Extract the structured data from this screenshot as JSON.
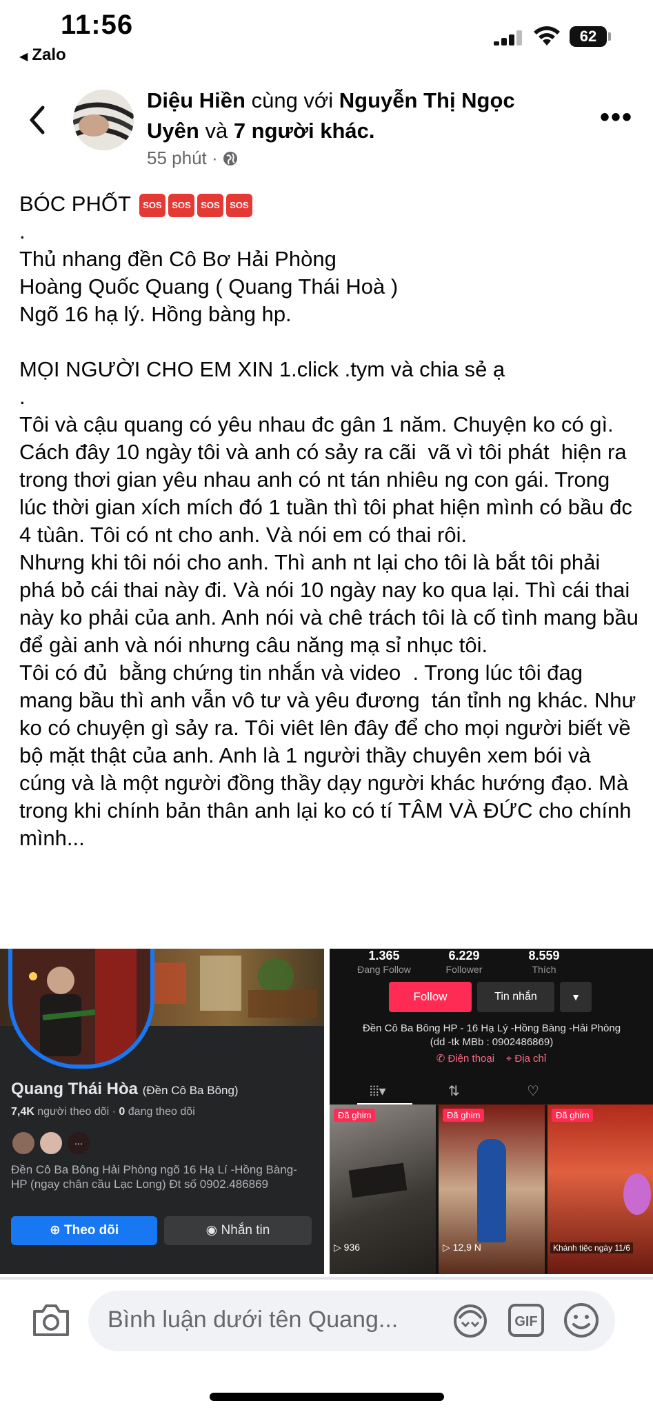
{
  "status_bar": {
    "time": "11:56",
    "back_app": "Zalo",
    "battery": "62"
  },
  "post": {
    "author": "Diệu Hiền",
    "with_text": "cùng với",
    "tagged": "Nguyễn Thị Ngọc Uyên",
    "and_text": "và",
    "others": "7 người khác",
    "time_ago": "55 phút",
    "title": "BÓC PHỐT",
    "sos_label": "SOS",
    "body": ".\nThủ nhang đền Cô Bơ Hải Phòng\nHoàng Quốc Quang ( Quang Thái Hoà )\nNgõ 16 hạ lý. Hồng bàng hp.\n\nMỌI NGƯỜI CHO EM XIN 1.click .tym và chia sẻ ạ\n.\nTôi và cậu quang có yêu nhau đc gân 1 năm. Chuyện ko có gì. Cách đây 10 ngày tôi và anh có sảy ra cãi  vã vì tôi phát  hiện ra trong thơi gian yêu nhau anh có nt tán nhiêu ng con gái. Trong lúc thời gian xích mích đó 1 tuần thì tôi phat hiện mình có bầu đc 4 tùân. Tôi có nt cho anh. Và nói em có thai rôi.\nNhưng khi tôi nói cho anh. Thì anh nt lại cho tôi là bắt tôi phải phá bỏ cái thai này đi. Và nói 10 ngày nay ko qua lại. Thì cái thai này ko phải của anh. Anh nói và chê trách tôi là cố tình mang bầu để gài anh và nói nhưng câu năng mạ sỉ nhục tôi.\nTôi có đủ  bằng chứng tin nhắn và video  . Trong lúc tôi đag mang bầu thì anh vẫn vô tư và yêu đương  tán tỉnh ng khác. Như ko có chuyện gì sảy ra. Tôi viêt lên đây để cho mọi người biết về bộ mặt thật của anh. Anh là 1 người thầy chuyên xem bói và cúng và là một người đồng thầy dạy người khác hướng đạo. Mà trong khi chính bản thân anh lại ko có tí TÂM VÀ ĐỨC cho chính mình..."
  },
  "fb_profile": {
    "name": "Quang Thái Hòa",
    "subname": "(Đền Cô Ba Bông)",
    "followers": "7,4K",
    "followers_label": "người theo dõi",
    "following": "0",
    "following_label": "đang theo dõi",
    "bio": "Đền Cô Ba Bông Hải Phòng ngõ 16 Hạ Lí -Hồng Bàng-HP (ngay chân cầu Lạc Long) Đt số 0902.486869",
    "follow_btn": "Theo dõi",
    "message_btn": "Nhắn tin",
    "more_dots": "..."
  },
  "tiktok_profile": {
    "stats": [
      {
        "num": "1.365",
        "label": "Đang Follow"
      },
      {
        "num": "6.229",
        "label": "Follower"
      },
      {
        "num": "8.559",
        "label": "Thích"
      }
    ],
    "follow_btn": "Follow",
    "message_btn": "Tin nhắn",
    "bio": "Đền Cô Ba Bông HP - 16 Hạ Lý -Hồng Bàng -Hải Phòng (dd -tk MBb : 0902486869)",
    "phone_link": "Điện thoại",
    "address_link": "Địa chỉ",
    "pinned_label": "Đã ghim",
    "videos": [
      {
        "views": "936"
      },
      {
        "views": "12,9 N"
      },
      {
        "views": ""
      }
    ],
    "video3_caption": "Khánh tiệc ngày 11/6"
  },
  "comment_bar": {
    "placeholder": "Bình luận dưới tên Quang..."
  },
  "colors": {
    "fb_blue": "#1877f2",
    "tiktok_red": "#fe2c55",
    "sos_red": "#e53935"
  }
}
